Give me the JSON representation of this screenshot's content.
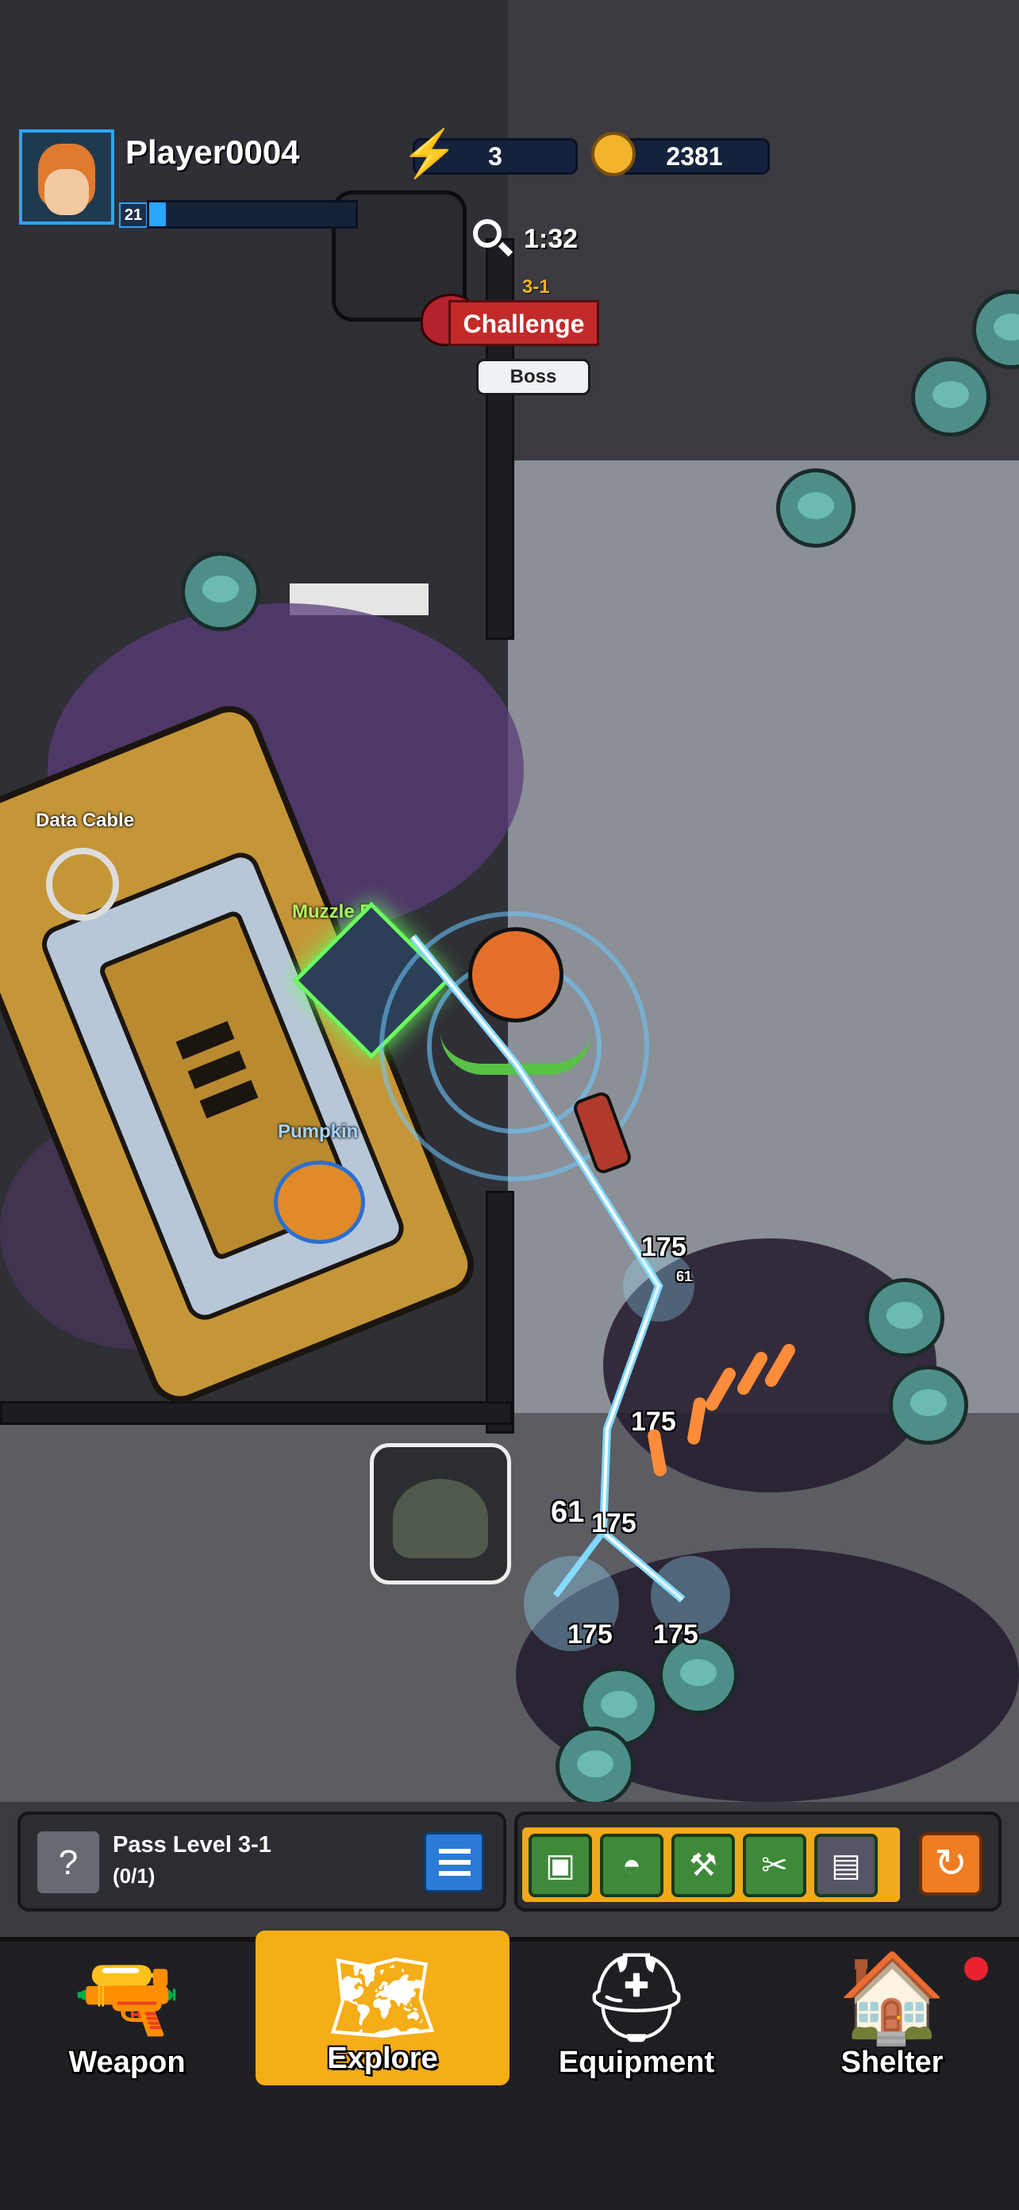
{
  "player": {
    "name": "Player0004",
    "level": "21",
    "xp_fraction": 0.08
  },
  "resources": {
    "energy": "3",
    "coins": "2381"
  },
  "timer": "1:32",
  "stage": {
    "label": "3-1",
    "challenge_label": "Challenge",
    "boss_label": "Boss"
  },
  "loot": {
    "data_cable": "Data Cable",
    "muzzle": "Muzzle P",
    "pumpkin": "Pumpkin"
  },
  "damage_numbers": [
    "175",
    "61",
    "175",
    "61",
    "175",
    "175",
    "175"
  ],
  "quest": {
    "title": "Pass Level 3-1",
    "progress": "(0/1)"
  },
  "nav": {
    "weapon": "Weapon",
    "explore": "Explore",
    "equipment": "Equipment",
    "shelter": "Shelter",
    "active": "explore"
  },
  "colors": {
    "accent_blue": "#2aa6ff",
    "explore_active": "#f5ad18",
    "challenge_red": "#c22a2a",
    "notification_red": "#e8222e"
  }
}
